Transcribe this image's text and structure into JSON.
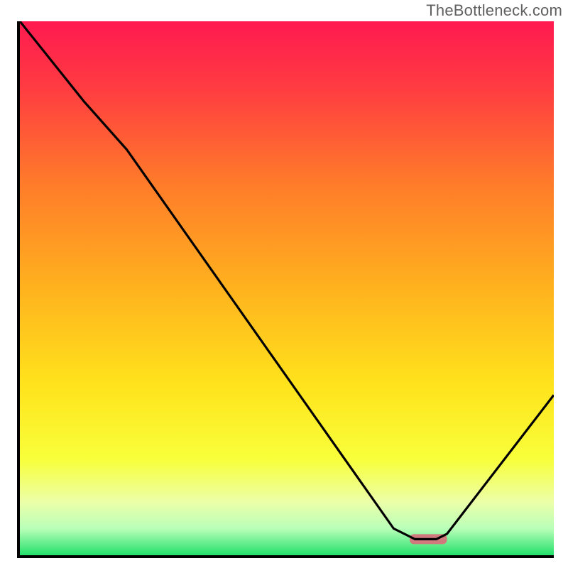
{
  "watermark": "TheBottleneck.com",
  "chart_data": {
    "type": "line",
    "title": "",
    "xlabel": "",
    "ylabel": "",
    "xlim": [
      0,
      100
    ],
    "ylim": [
      0,
      100
    ],
    "series": [
      {
        "name": "curve",
        "x": [
          0,
          12,
          20,
          70,
          74,
          78,
          80,
          100
        ],
        "y": [
          100,
          85,
          76,
          5,
          3,
          3,
          4,
          30
        ]
      }
    ],
    "marker": {
      "x_start": 73,
      "x_end": 80,
      "y": 3,
      "color": "#d07a7d"
    },
    "gradient_stops": [
      {
        "offset": 0.0,
        "color": "#ff1a50"
      },
      {
        "offset": 0.12,
        "color": "#ff3a42"
      },
      {
        "offset": 0.3,
        "color": "#ff7a2a"
      },
      {
        "offset": 0.5,
        "color": "#ffb21e"
      },
      {
        "offset": 0.68,
        "color": "#ffe31c"
      },
      {
        "offset": 0.82,
        "color": "#f8ff3a"
      },
      {
        "offset": 0.9,
        "color": "#ecffa8"
      },
      {
        "offset": 0.95,
        "color": "#b9ffb9"
      },
      {
        "offset": 1.0,
        "color": "#23e06a"
      }
    ]
  }
}
